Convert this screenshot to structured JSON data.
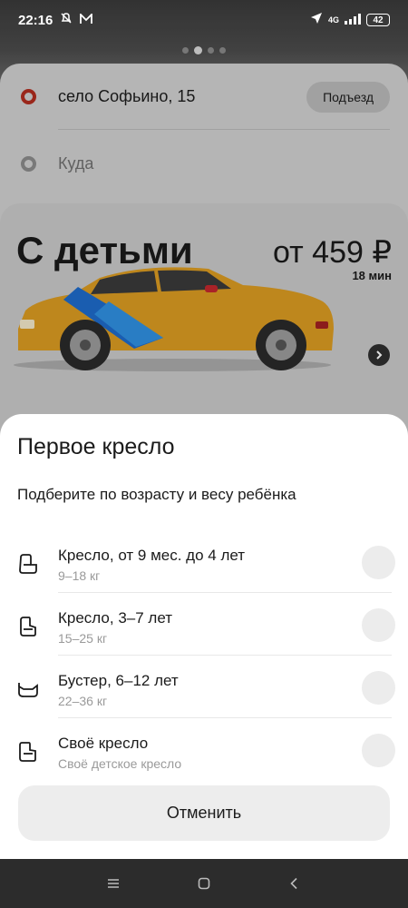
{
  "status_bar": {
    "time": "22:16",
    "network": "4G",
    "battery": "42"
  },
  "route": {
    "from": "село Софьино, 15",
    "entrance_button": "Подъезд",
    "to_placeholder": "Куда"
  },
  "promo": {
    "title": "С детьми",
    "price": "от 459 ₽",
    "eta": "18 мин"
  },
  "sheet": {
    "title": "Первое кресло",
    "subtitle": "Подберите по возрасту и весу ребёнка",
    "options": [
      {
        "title": "Кресло, от 9 мес. до 4 лет",
        "subtitle": "9–18 кг",
        "icon": "infant-seat-icon"
      },
      {
        "title": "Кресло, 3–7 лет",
        "subtitle": "15–25 кг",
        "icon": "child-seat-icon"
      },
      {
        "title": "Бустер, 6–12 лет",
        "subtitle": "22–36 кг",
        "icon": "booster-icon"
      },
      {
        "title": "Своё кресло",
        "subtitle": "Своё детское кресло",
        "icon": "own-seat-icon"
      }
    ],
    "cancel_label": "Отменить"
  },
  "colors": {
    "accent_from": "#b02d1f",
    "taxi_yellow": "#e2a427",
    "taxi_blue": "#2f8fe0"
  }
}
